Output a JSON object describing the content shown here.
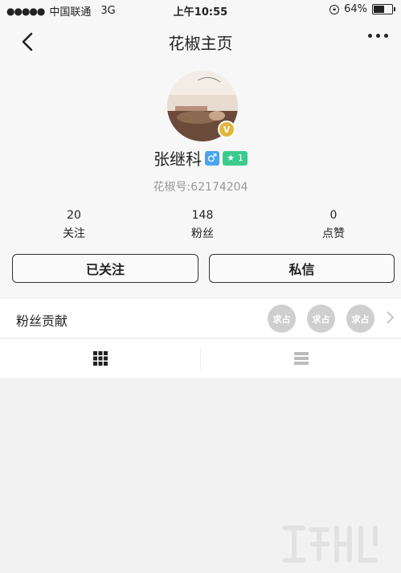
{
  "status_bar": {
    "signal_dots": "●●●●●",
    "carrier": "中国联通",
    "network": "3G",
    "time": "上午10:55",
    "battery": "64%",
    "battery_level": 0.64
  },
  "header": {
    "title": "花椒主页",
    "back_icon": "chevron-left-icon",
    "more_icon": "more-dots-icon"
  },
  "profile": {
    "verified_badge": "V",
    "name": "张继科",
    "gender_symbol": "♂",
    "level_star": "★",
    "level": "1",
    "flower_id": "花椒号:62174204"
  },
  "stats": [
    {
      "value": "20",
      "label": "关注"
    },
    {
      "value": "148",
      "label": "粉丝"
    },
    {
      "value": "0",
      "label": "点赞"
    }
  ],
  "actions": {
    "follow_label": "已关注",
    "message_label": "私信"
  },
  "fans_contribution": {
    "label": "粉丝贡献",
    "avatars": [
      "求占",
      "求占",
      "求占"
    ]
  },
  "tabs": [
    {
      "icon": "grid-icon"
    },
    {
      "icon": "list-icon"
    }
  ],
  "colors": {
    "gender_blue": "#4aa3f0",
    "level_green": "#3bcb8e",
    "verified_gold": "#e3b53a"
  }
}
